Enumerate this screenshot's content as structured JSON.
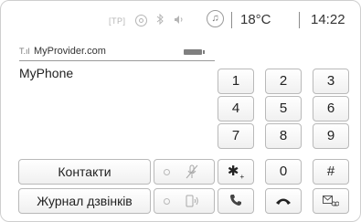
{
  "status": {
    "temperature": "18°C",
    "time": "14:22",
    "icons": [
      "tp-icon",
      "ring-icon",
      "bluetooth-icon",
      "volume-icon",
      "music-note-icon"
    ],
    "tp_label": "[TP]"
  },
  "phone": {
    "provider": "MyProvider.com",
    "device_name": "MyPhone"
  },
  "buttons": {
    "contacts": "Контакти",
    "call_log": "Журнал дзвінків"
  },
  "keypad": {
    "keys": [
      "1",
      "2",
      "3",
      "4",
      "5",
      "6",
      "7",
      "8",
      "9",
      "✱",
      "0",
      "#"
    ],
    "star_sub": "+",
    "action_icons": [
      "call-icon",
      "hang-up-icon",
      "voicemail-icon"
    ]
  },
  "colors": {
    "key_border": "#b9b9b9",
    "icon_grey": "#b5b5b5",
    "text": "#222222"
  }
}
